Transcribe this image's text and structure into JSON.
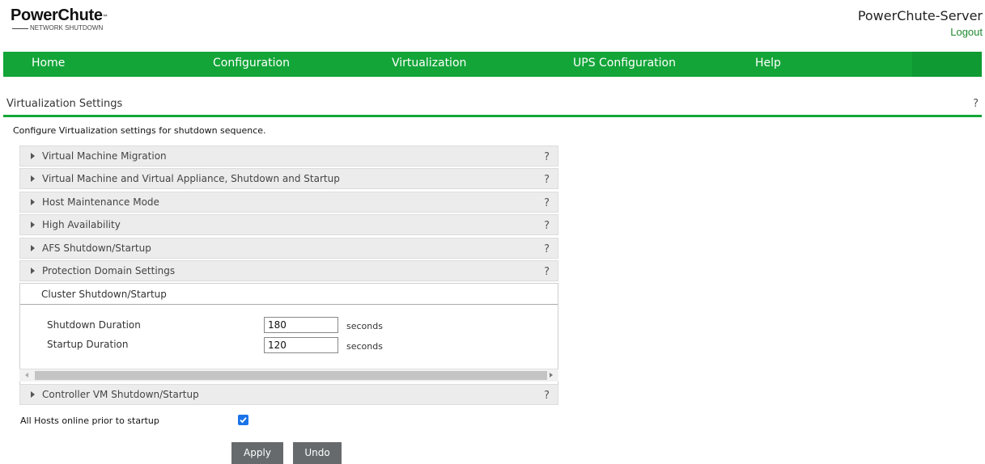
{
  "header": {
    "logo_text": "PowerChute",
    "logo_tm": "™",
    "logo_subtext": "NETWORK SHUTDOWN",
    "app_title": "PowerChute-Server",
    "logout_label": "Logout"
  },
  "nav": {
    "items": [
      {
        "label": "Home"
      },
      {
        "label": "Configuration"
      },
      {
        "label": "Virtualization"
      },
      {
        "label": "UPS Configuration"
      },
      {
        "label": "Help"
      }
    ]
  },
  "section": {
    "title": "Virtualization Settings",
    "help": "?",
    "description": "Configure Virtualization settings for shutdown sequence."
  },
  "accordions": [
    {
      "label": "Virtual Machine Migration",
      "help": "?"
    },
    {
      "label": "Virtual Machine and Virtual Appliance, Shutdown and Startup",
      "help": "?"
    },
    {
      "label": "Host Maintenance Mode",
      "help": "?"
    },
    {
      "label": "High Availability",
      "help": "?"
    },
    {
      "label": "AFS Shutdown/Startup",
      "help": "?"
    },
    {
      "label": "Protection Domain Settings",
      "help": "?"
    }
  ],
  "cluster": {
    "label": "Cluster Shutdown/Startup",
    "shutdown_label": "Shutdown Duration",
    "shutdown_value": "180",
    "startup_label": "Startup Duration",
    "startup_value": "120",
    "unit": "seconds"
  },
  "controller": {
    "label": "Controller VM Shutdown/Startup",
    "help": "?"
  },
  "hosts_online": {
    "label": "All Hosts online prior to startup",
    "checked": true
  },
  "buttons": {
    "apply": "Apply",
    "undo": "Undo"
  },
  "colors": {
    "brand_green": "#13a538",
    "checkbox_blue": "#1a73e8",
    "button_gray": "#666a6d"
  }
}
